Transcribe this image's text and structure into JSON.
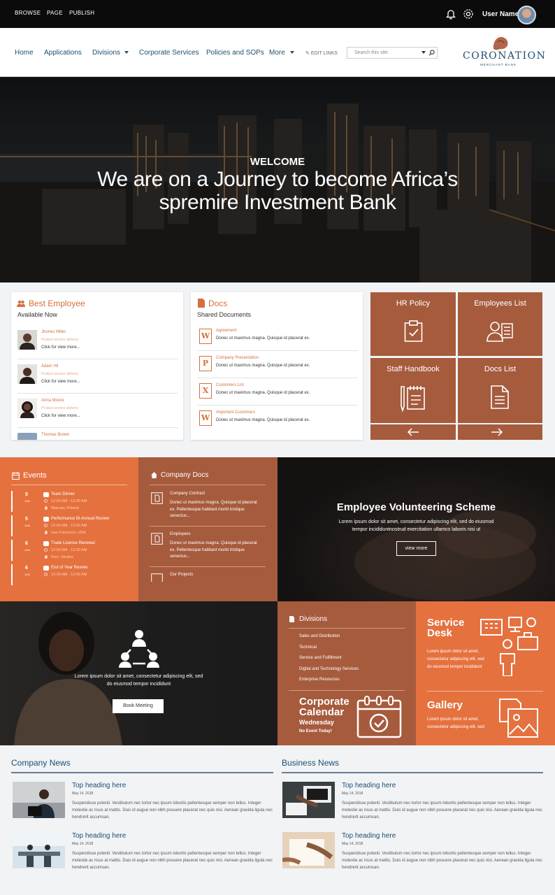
{
  "topbar": {
    "links": [
      "BROWSE",
      "PAGE",
      "PUBLISH"
    ],
    "user_name": "User Name"
  },
  "nav": {
    "items": [
      "Home",
      "Applications",
      "Divisions",
      "Corporate Services",
      "Policies and SOPs",
      "More"
    ],
    "edit_links": "EDIT LINKS",
    "search_placeholder": "Search this site",
    "brand": "CORONATION",
    "brand_sub": "MERCHANT BANK"
  },
  "hero": {
    "welcome": "WELCOME",
    "line1": "We are on a Journey to become Africa’s",
    "line2": "spremire Investment Bank"
  },
  "best_employee": {
    "title": "Best Employee",
    "subtitle": "Available Now",
    "people": [
      {
        "name": "Jhones Miller",
        "role": "Product service delivery",
        "link": "Click for view more..."
      },
      {
        "name": "Adam Hil",
        "role": "Product service delivery",
        "link": "Click for view more..."
      },
      {
        "name": "Anna Moore",
        "role": "Product service delivery",
        "link": "Click for view more..."
      },
      {
        "name": "Thomas Brown"
      }
    ]
  },
  "docs": {
    "title": "Docs",
    "subtitle": "Shared Documents",
    "items": [
      {
        "type": "W",
        "name": "Agreement",
        "desc": "Donec ut maximus magna. Quisque id placerat ex."
      },
      {
        "type": "P",
        "name": "Company Presentation",
        "desc": "Donec ut maximus magna. Quisque id placerat ex."
      },
      {
        "type": "X",
        "name": "Customers List",
        "desc": "Donec ut maximus magna. Quisque id placerat ex."
      },
      {
        "type": "W",
        "name": "Important Customers",
        "desc": "Donec ut maximus magna. Quisque id placerat ex."
      }
    ]
  },
  "tiles": [
    "HR Policy",
    "Employees List",
    "Staff Handbook",
    "Docs List"
  ],
  "events": {
    "title": "Events",
    "items": [
      {
        "day": "5",
        "month": "JUN",
        "name": "Team Dinner",
        "time": "12:00 AM - 12:00 AM",
        "place": "Warsaw, Poland"
      },
      {
        "day": "5",
        "month": "JUN",
        "name": "Performance Bi-Annual Review",
        "time": "12:00 AM - 12:00 AM",
        "place": "San Francisco, USA"
      },
      {
        "day": "6",
        "month": "JUN",
        "name": "Trade License Renewal",
        "time": "12:00 AM - 12:00 AM",
        "place": "Kiev, Ukraine"
      },
      {
        "day": "6",
        "month": "JUN",
        "name": "End of Year Review",
        "time": "12:00 AM - 12:00 AM"
      }
    ]
  },
  "company_docs": {
    "title": "Company Docs",
    "items": [
      {
        "name": "Company Contract",
        "desc": "Donec ut maximus magna. Quisque id placerat ex. Pellentesque habitant morbi tristique senectus..."
      },
      {
        "name": "Employees",
        "desc": "Donec ut maximus magna. Quisque id placerat ex. Pellentesque habitant morbi tristique senectus..."
      },
      {
        "name": "Our Projects"
      }
    ]
  },
  "volunteering": {
    "title": "Employee Volunteering Scheme",
    "text1": "Lorem ipsum dolor sit amet, consectetur adipiscing elit, sed do eiusmod",
    "text2": "tempor incididuntnostrud exercitation ullamco laboris nisi ut",
    "button": "view more"
  },
  "meeting": {
    "text1": "Lorem ipsum dolor sit amet, consectetur adipiscing elit, sed",
    "text2": "do eiusmod tempor incididunt",
    "button": "Book Meeting"
  },
  "divisions": {
    "title": "Divisions",
    "items": [
      "Sales and Distribution",
      "Technical",
      "Service and Fulfillment",
      "Digital and Technology Services",
      "Enterprise Resources"
    ]
  },
  "calendar": {
    "title1": "Corporate",
    "title2": "Calendar",
    "day": "Wednesday",
    "note": "No Event Today!"
  },
  "service_desk": {
    "title1": "Service",
    "title2": "Desk",
    "text": [
      "Lorem ipsum dolor sit amet,",
      "consectetur adipiscing elit, sed",
      "do eiusmod tempor incididunt"
    ]
  },
  "gallery": {
    "title": "Gallery",
    "text": [
      "Lorem ipsum dolor sit amet,",
      "consectetur adipiscing elit, sed"
    ]
  },
  "company_news": {
    "title": "Company News",
    "items": [
      {
        "heading": "Top heading here",
        "date": "May 14, 2018",
        "body": "Suspendisse potenti. Vestibulum nec tortor nec ipsum lobortis pellentesque semper non tellus. Integer molestie ac risus at mattis. Duis id augue non nibh posuere placerat nec quis nisi. Aenean gravida ligula nec hendrerit accumsan."
      },
      {
        "heading": "Top heading here",
        "date": "May 14, 2018",
        "body": "Suspendisse potenti. Vestibulum nec tortor nec ipsum lobortis pellentesque semper non tellus. Integer molestie ac risus at mattis. Duis id augue non nibh posuere placerat nec quis nisi. Aenean gravida ligula nec hendrerit accumsan."
      }
    ]
  },
  "business_news": {
    "title": "Business News",
    "items": [
      {
        "heading": "Top heading here",
        "date": "May 14, 2018",
        "body": "Suspendisse potenti. Vestibulum nec tortor nec ipsum lobortis pellentesque semper non tellus. Integer molestie ac risus at mattis. Duis id augue non nibh posuere placerat nec quis nisi. Aenean gravida ligula nec hendrerit accumsan."
      },
      {
        "heading": "Top heading here",
        "date": "May 14, 2018",
        "body": "Suspendisse potenti. Vestibulum nec tortor nec ipsum lobortis pellentesque semper non tellus. Integer molestie ac risus at mattis. Duis id augue non nibh posuere placerat nec quis nisi. Aenean gravida ligula nec hendrerit accumsan."
      }
    ]
  },
  "colors": {
    "accent": "#e5713f",
    "brown": "#a65b3d",
    "navy": "#1d4e6f"
  }
}
